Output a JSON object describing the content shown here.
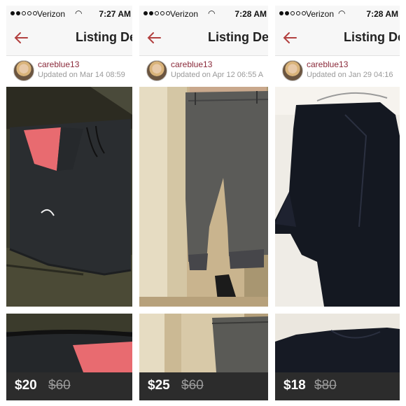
{
  "panels": [
    {
      "status": {
        "carrier": "Verizon",
        "time": "7:27 AM"
      },
      "nav": {
        "title": "Listing Det"
      },
      "seller": {
        "username": "careblue13",
        "updated": "Updated on Mar 14 08:59"
      },
      "price": {
        "current": "$20",
        "original": "$60"
      }
    },
    {
      "status": {
        "carrier": "Verizon",
        "time": "7:28 AM"
      },
      "nav": {
        "title": "Listing Det"
      },
      "seller": {
        "username": "careblue13",
        "updated": "Updated on Apr 12 06:55 A"
      },
      "price": {
        "current": "$25",
        "original": "$60"
      }
    },
    {
      "status": {
        "carrier": "Verizon",
        "time": "7:28 AM"
      },
      "nav": {
        "title": "Listing De"
      },
      "seller": {
        "username": "careblue13",
        "updated": "Updated on Jan 29 04:16"
      },
      "price": {
        "current": "$18",
        "original": "$80"
      }
    }
  ],
  "colors": {
    "accent": "#8a2a3a",
    "back_arrow": "#b2403f",
    "price_bar": "#1c1c1c",
    "bar_background": "#f7f7f7"
  },
  "icons": [
    "signal-dots-icon",
    "wifi-icon",
    "back-arrow-icon"
  ]
}
